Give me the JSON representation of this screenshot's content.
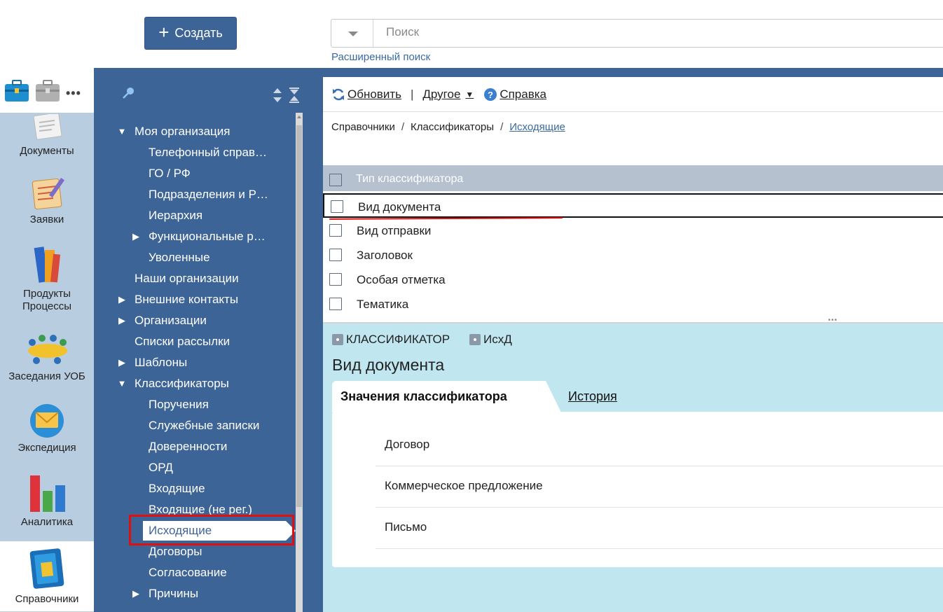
{
  "header": {
    "create_label": "Создать",
    "search_placeholder": "Поиск",
    "advanced_search": "Расширенный поиск"
  },
  "rail": {
    "items": [
      {
        "label": "Документы",
        "icon": "documents-icon"
      },
      {
        "label": "Заявки",
        "icon": "requests-icon"
      },
      {
        "label": "Продукты\nПроцессы",
        "line1": "Продукты",
        "line2": "Процессы",
        "icon": "products-icon"
      },
      {
        "label": "Заседания УОБ",
        "icon": "meetings-icon"
      },
      {
        "label": "Экспедиция",
        "icon": "expedition-icon"
      },
      {
        "label": "Аналитика",
        "icon": "analytics-icon"
      },
      {
        "label": "Справочники",
        "icon": "directories-icon",
        "active": true
      }
    ]
  },
  "tree": {
    "items": [
      {
        "label": "Моя организация",
        "level": 0,
        "arrow": "▼"
      },
      {
        "label": "Телефонный справ…",
        "level": 1
      },
      {
        "label": "ГО / РФ",
        "level": 1
      },
      {
        "label": "Подразделения и Р…",
        "level": 1
      },
      {
        "label": "Иерархия",
        "level": 1
      },
      {
        "label": "Функциональные р…",
        "level": 1,
        "arrow": "▶"
      },
      {
        "label": "Уволенные",
        "level": 1
      },
      {
        "label": "Наши организации",
        "level": 0
      },
      {
        "label": "Внешние контакты",
        "level": 0,
        "arrow": "▶"
      },
      {
        "label": "Организации",
        "level": 0,
        "arrow": "▶"
      },
      {
        "label": "Списки рассылки",
        "level": 0
      },
      {
        "label": "Шаблоны",
        "level": 0,
        "arrow": "▶"
      },
      {
        "label": "Классификаторы",
        "level": 0,
        "arrow": "▼"
      },
      {
        "label": "Поручения",
        "level": 1
      },
      {
        "label": "Служебные записки",
        "level": 1
      },
      {
        "label": "Доверенности",
        "level": 1
      },
      {
        "label": "ОРД",
        "level": 1
      },
      {
        "label": "Входящие",
        "level": 1
      },
      {
        "label": "Входящие (не рег.)",
        "level": 1
      },
      {
        "label": "Исходящие",
        "level": 1,
        "selected": true
      },
      {
        "label": "Договоры",
        "level": 1
      },
      {
        "label": "Согласование",
        "level": 1
      },
      {
        "label": "Причины",
        "level": 1,
        "arrow": "▶"
      }
    ]
  },
  "toolbar": {
    "refresh": "Обновить",
    "other": "Другое",
    "help": "Справка"
  },
  "breadcrumb": {
    "b1": "Справочники",
    "b2": "Классификаторы",
    "b3": "Исходящие"
  },
  "grid": {
    "header": "Тип классификатора",
    "rows": [
      "Вид документа",
      "Вид отправки",
      "Заголовок",
      "Особая отметка",
      "Тематика"
    ]
  },
  "detail": {
    "tag1": "КЛАССИФИКАТОР",
    "tag2": "ИсхД",
    "title": "Вид документа",
    "tab_values": "Значения классификатора",
    "tab_history": "История",
    "values": [
      "Договор",
      "Коммерческое предложение",
      "Письмо"
    ]
  },
  "colors": {
    "primary": "#3d6496",
    "rail": "#b9cde0",
    "detail_bg": "#c0e6f0",
    "highlight": "#e01010"
  }
}
